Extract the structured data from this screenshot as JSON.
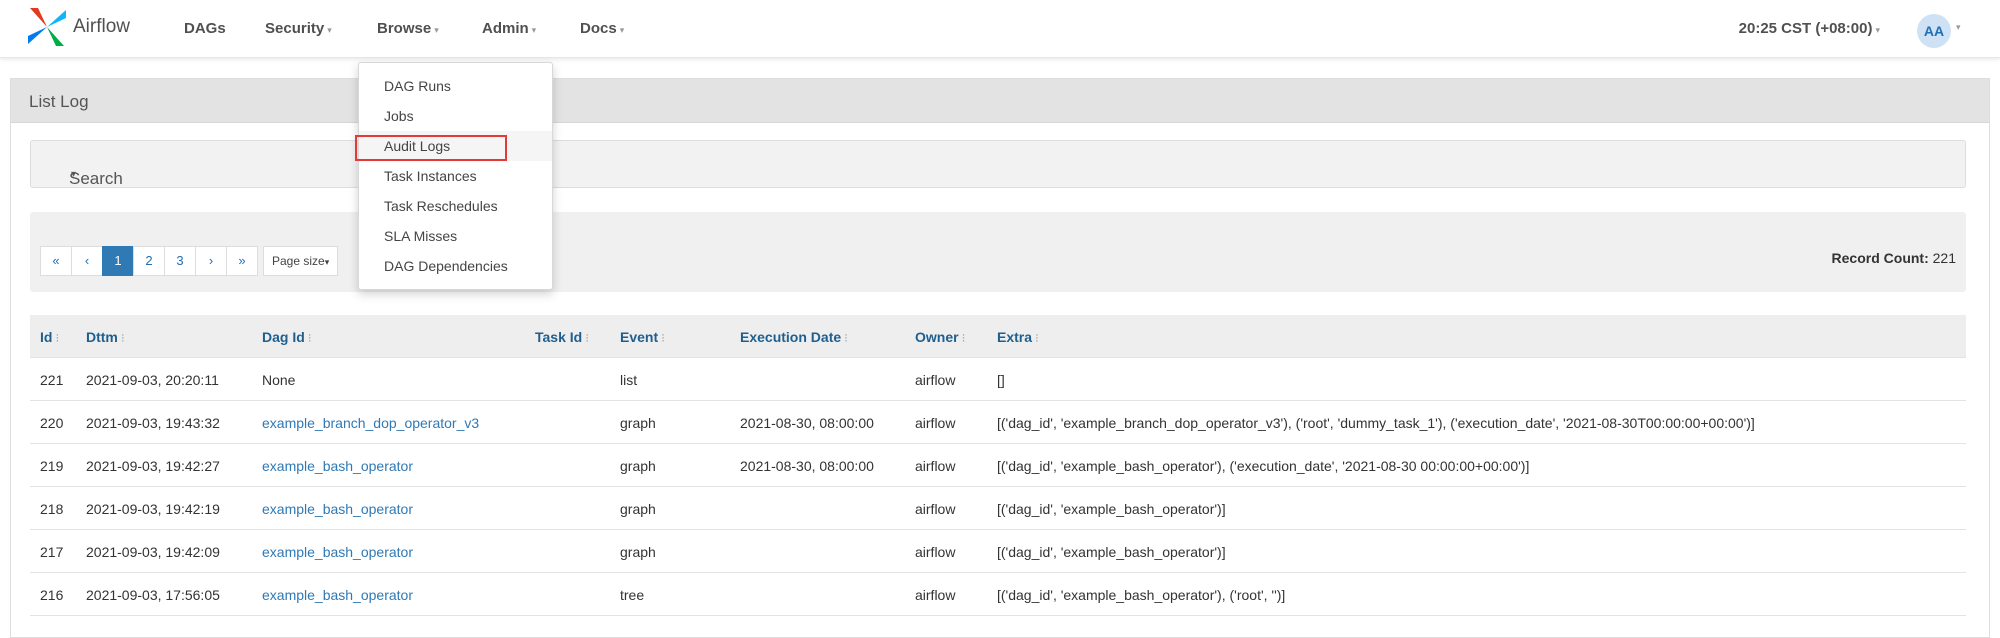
{
  "app": {
    "brand": "Airflow"
  },
  "nav": {
    "items": [
      {
        "label": "DAGs",
        "caret": false
      },
      {
        "label": "Security",
        "caret": true
      },
      {
        "label": "Browse",
        "caret": true
      },
      {
        "label": "Admin",
        "caret": true
      },
      {
        "label": "Docs",
        "caret": true
      }
    ],
    "clock": "20:25 CST (+08:00)",
    "avatar": "AA"
  },
  "browse_menu": {
    "items": [
      "DAG Runs",
      "Jobs",
      "Audit Logs",
      "Task Instances",
      "Task Reschedules",
      "SLA Misses",
      "DAG Dependencies"
    ],
    "highlighted": "Audit Logs"
  },
  "panel": {
    "title": "List Log"
  },
  "search": {
    "label": "Search"
  },
  "pagination": {
    "buttons": [
      "«",
      "‹",
      "1",
      "2",
      "3",
      "›",
      "»"
    ],
    "active_page": "1",
    "page_size_label": "Page size"
  },
  "record_count": {
    "label": "Record Count:",
    "value": "221"
  },
  "table": {
    "columns": [
      "Id",
      "Dttm",
      "Dag Id",
      "Task Id",
      "Event",
      "Execution Date",
      "Owner",
      "Extra"
    ],
    "rows": [
      {
        "id": "221",
        "dttm": "2021-09-03, 20:20:11",
        "dag_id": "None",
        "task_id": "",
        "event": "list",
        "execution_date": "",
        "owner": "airflow",
        "extra": "[]"
      },
      {
        "id": "220",
        "dttm": "2021-09-03, 19:43:32",
        "dag_id": "example_branch_dop_operator_v3",
        "task_id": "",
        "event": "graph",
        "execution_date": "2021-08-30, 08:00:00",
        "owner": "airflow",
        "extra": "[('dag_id', 'example_branch_dop_operator_v3'), ('root', 'dummy_task_1'), ('execution_date', '2021-08-30T00:00:00+00:00')]"
      },
      {
        "id": "219",
        "dttm": "2021-09-03, 19:42:27",
        "dag_id": "example_bash_operator",
        "task_id": "",
        "event": "graph",
        "execution_date": "2021-08-30, 08:00:00",
        "owner": "airflow",
        "extra": "[('dag_id', 'example_bash_operator'), ('execution_date', '2021-08-30 00:00:00+00:00')]"
      },
      {
        "id": "218",
        "dttm": "2021-09-03, 19:42:19",
        "dag_id": "example_bash_operator",
        "task_id": "",
        "event": "graph",
        "execution_date": "",
        "owner": "airflow",
        "extra": "[('dag_id', 'example_bash_operator')]"
      },
      {
        "id": "217",
        "dttm": "2021-09-03, 19:42:09",
        "dag_id": "example_bash_operator",
        "task_id": "",
        "event": "graph",
        "execution_date": "",
        "owner": "airflow",
        "extra": "[('dag_id', 'example_bash_operator')]"
      },
      {
        "id": "216",
        "dttm": "2021-09-03, 17:56:05",
        "dag_id": "example_bash_operator",
        "task_id": "",
        "event": "tree",
        "execution_date": "",
        "owner": "airflow",
        "extra": "[('dag_id', 'example_bash_operator'), ('root', '')]"
      }
    ]
  }
}
